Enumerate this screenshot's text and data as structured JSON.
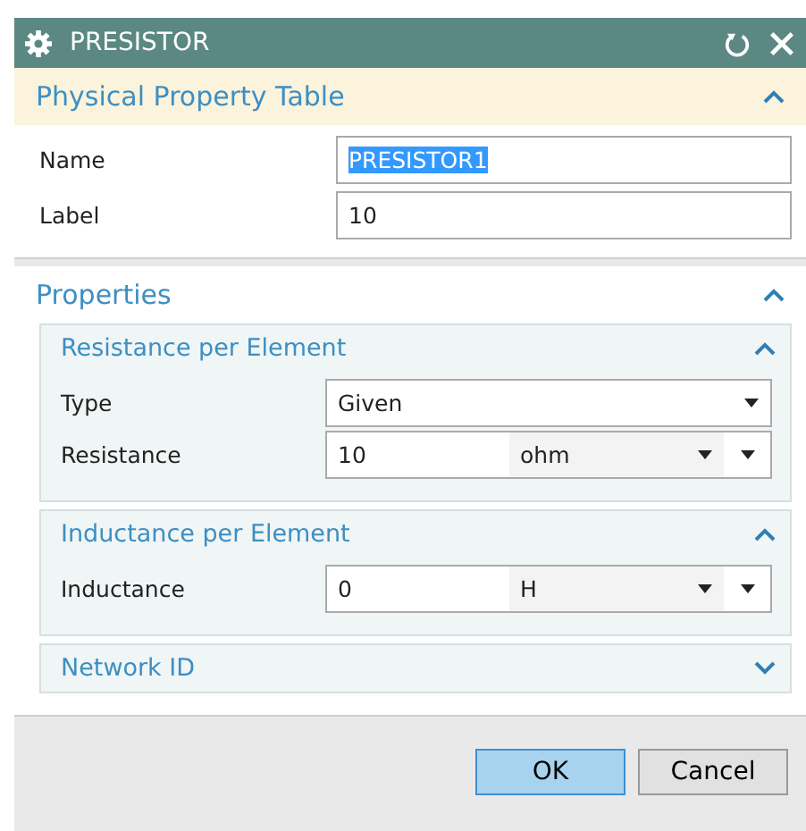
{
  "window": {
    "title": "PRESISTOR"
  },
  "sections": [
    {
      "title": "Physical Property Table",
      "expanded": true,
      "fields": [
        {
          "kind": "text",
          "label": "Name",
          "value": "PRESISTOR1",
          "selected": true
        },
        {
          "kind": "text",
          "label": "Label",
          "value": "10",
          "selected": false
        }
      ]
    },
    {
      "title": "Properties",
      "expanded": true,
      "groups": [
        {
          "title": "Resistance per Element",
          "expanded": true,
          "fields": [
            {
              "kind": "dropdown",
              "label": "Type",
              "value": "Given"
            },
            {
              "kind": "value_unit",
              "label": "Resistance",
              "value": "10",
              "unit": "ohm"
            }
          ]
        },
        {
          "title": "Inductance per Element",
          "expanded": true,
          "fields": [
            {
              "kind": "value_unit",
              "label": "Inductance",
              "value": "0",
              "unit": "H"
            }
          ]
        },
        {
          "title": "Network ID",
          "expanded": false
        }
      ]
    }
  ],
  "buttons": [
    {
      "label": "OK",
      "kind": "primary"
    },
    {
      "label": "Cancel",
      "kind": "secondary"
    }
  ]
}
